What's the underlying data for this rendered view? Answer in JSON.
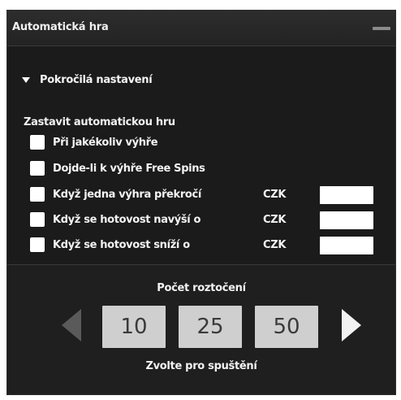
{
  "panel": {
    "title": "Automatická hra"
  },
  "advanced": {
    "label": "Pokročilá nastavení",
    "expanded": true
  },
  "stop_section": {
    "title": "Zastavit automatickou hru",
    "options": [
      {
        "label": "Při jakékoliv výhře",
        "checked": false
      },
      {
        "label": "Dojde-li k výhře Free Spins",
        "checked": false
      },
      {
        "label": "Když jedna výhra překročí",
        "checked": false,
        "currency": "CZK",
        "value": ""
      },
      {
        "label": "Když se hotovost navýší o",
        "checked": false,
        "currency": "CZK",
        "value": ""
      },
      {
        "label": "Když se hotovost sníží o",
        "checked": false,
        "currency": "CZK",
        "value": ""
      }
    ]
  },
  "spins": {
    "title": "Počet roztočení",
    "choices": [
      "10",
      "25",
      "50"
    ],
    "hint": "Zvolte pro spuštění"
  },
  "colors": {
    "panel_bg": "#1b1b1b",
    "header_bg": "#2d2d2d",
    "text": "#f3f3f3",
    "spin_button_bg": "#cfcfcf",
    "arrow_active": "#f2f2f2",
    "arrow_inactive": "#5a5a5a"
  },
  "icons": {
    "minimize": "minimize-icon",
    "expand": "triangle-down-icon",
    "prev": "arrow-left-icon",
    "next": "arrow-right-icon"
  }
}
